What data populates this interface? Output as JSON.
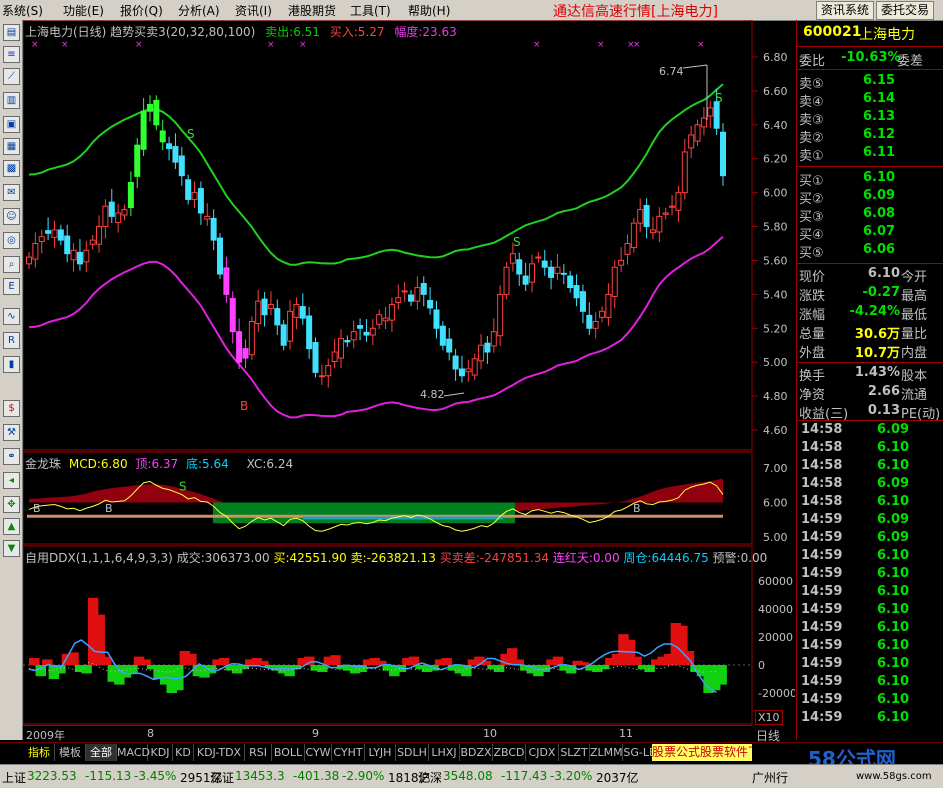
{
  "menu": [
    "系统(S)",
    "功能(E)",
    "报价(Q)",
    "分析(A)",
    "资讯(I)",
    "港股期货",
    "工具(T)",
    "帮助(H)"
  ],
  "app_title": "通达信高速行情[上海电力]",
  "top_buttons": [
    "资讯系统",
    "委托交易"
  ],
  "toolbar_icons": [
    "page-icon",
    "list-icon",
    "kline-icon",
    "chart-icon",
    "report-icon",
    "table-icon",
    "grid-icon",
    "mail-icon",
    "users-icon",
    "news-icon",
    "magnify-icon",
    "etf-icon",
    "wave-icon",
    "rsi-icon",
    "rank-icon",
    "dollar-icon",
    "tools-icon",
    "link-icon",
    "arrow-left-icon",
    "cross-icon",
    "arrow-up-icon",
    "arrow-down-icon"
  ],
  "main": {
    "title": "上海电力(日线) 趋势买卖3(20,32,80,100)",
    "sell_label": "卖出:6.51",
    "buy_label": "买入:5.27",
    "range_label": "幅度:23.63",
    "high_annot": "6.74",
    "low_annot": "4.82",
    "y_ticks": [
      "6.80",
      "6.60",
      "6.40",
      "6.20",
      "6.00",
      "5.80",
      "5.60",
      "5.40",
      "5.20",
      "5.00",
      "4.80",
      "4.60"
    ],
    "signal_s": "S",
    "signal_b": "B"
  },
  "sub1": {
    "name": "金龙珠",
    "mcd": "MCD:6.80",
    "top": "顶:6.37",
    "bottom": "底:5.64",
    "xc": "XC:6.24",
    "y_ticks": [
      "7.00",
      "6.00",
      "5.00"
    ],
    "mark_b": "B",
    "mark_s": "S"
  },
  "sub2": {
    "name": "自用DDX(1,1,1,6,4,9,3,3)",
    "vol": "成交:306373.00",
    "buy": "买:42551.90",
    "sell": "卖:-263821.13",
    "diff": "买卖差:-247851.34",
    "red_days": "连红天:0.00",
    "week": "周仓:64446.75",
    "alert": "预警:0.00",
    "y_ticks": [
      "60000",
      "40000",
      "20000",
      "0",
      "-20000"
    ],
    "scale": "X10"
  },
  "xaxis": {
    "year": "2009年",
    "months": [
      "8",
      "9",
      "10",
      "11"
    ],
    "period": "日线"
  },
  "quote": {
    "code": "600021",
    "name": "上海电力",
    "wb_label": "委比",
    "wb_value": "-10.63%",
    "wc_label": "委差",
    "asks": [
      {
        "l": "卖⑤",
        "p": "6.15"
      },
      {
        "l": "卖④",
        "p": "6.14"
      },
      {
        "l": "卖③",
        "p": "6.13"
      },
      {
        "l": "卖②",
        "p": "6.12"
      },
      {
        "l": "卖①",
        "p": "6.11"
      }
    ],
    "bids": [
      {
        "l": "买①",
        "p": "6.10"
      },
      {
        "l": "买②",
        "p": "6.09"
      },
      {
        "l": "买③",
        "p": "6.08"
      },
      {
        "l": "买④",
        "p": "6.07"
      },
      {
        "l": "买⑤",
        "p": "6.06"
      }
    ],
    "stats": [
      {
        "l": "现价",
        "v": "6.10",
        "r": "今开"
      },
      {
        "l": "涨跌",
        "v": "-0.27",
        "r": "最高"
      },
      {
        "l": "涨幅",
        "v": "-4.24%",
        "r": "最低"
      },
      {
        "l": "总量",
        "v": "30.6万",
        "r": "量比"
      },
      {
        "l": "外盘",
        "v": "10.7万",
        "r": "内盘"
      },
      {
        "l": "换手",
        "v": "1.43%",
        "r": "股本"
      },
      {
        "l": "净资",
        "v": "2.66",
        "r": "流通"
      },
      {
        "l": "收益(三)",
        "v": "0.13",
        "r": "PE(动)"
      }
    ],
    "ticks": [
      {
        "t": "14:58",
        "p": "6.09",
        "c": "g"
      },
      {
        "t": "14:58",
        "p": "6.10",
        "c": "g"
      },
      {
        "t": "14:58",
        "p": "6.10",
        "c": "g"
      },
      {
        "t": "14:58",
        "p": "6.09",
        "c": "g"
      },
      {
        "t": "14:58",
        "p": "6.10",
        "c": "g"
      },
      {
        "t": "14:59",
        "p": "6.09",
        "c": "g"
      },
      {
        "t": "14:59",
        "p": "6.09",
        "c": "g"
      },
      {
        "t": "14:59",
        "p": "6.10",
        "c": "g"
      },
      {
        "t": "14:59",
        "p": "6.10",
        "c": "g"
      },
      {
        "t": "14:59",
        "p": "6.10",
        "c": "g"
      },
      {
        "t": "14:59",
        "p": "6.10",
        "c": "g"
      },
      {
        "t": "14:59",
        "p": "6.10",
        "c": "g"
      },
      {
        "t": "14:59",
        "p": "6.10",
        "c": "g"
      },
      {
        "t": "14:59",
        "p": "6.10",
        "c": "g"
      },
      {
        "t": "14:59",
        "p": "6.10",
        "c": "g"
      },
      {
        "t": "14:59",
        "p": "6.10",
        "c": "g"
      },
      {
        "t": "14:59",
        "p": "6.10",
        "c": "g"
      }
    ]
  },
  "tabs": [
    "指标",
    "模板",
    "全部",
    "MACD",
    "KDJ",
    "KD",
    "KDJ-TDX",
    "RSI",
    "BOLL",
    "CYW",
    "CYHT",
    "LYJH",
    "SDLH",
    "LHXJ",
    "BDZX",
    "ZBCD",
    "CJDX",
    "SLZT",
    "ZLMM",
    "SG-LB"
  ],
  "ad_text": "股票公式股票软件下载",
  "status": [
    {
      "n": "上证",
      "v": "3223.53",
      "c": "-115.13",
      "p": "-3.45%",
      "a": "2951亿"
    },
    {
      "n": "深证",
      "v": "13453.3",
      "c": "-401.38",
      "p": "-2.90%",
      "a": "1818亿"
    },
    {
      "n": "沪深",
      "v": "3548.08",
      "c": "-117.43",
      "p": "-3.20%",
      "a": "2037亿"
    }
  ],
  "status_tail": "广州行",
  "watermark": "58公式网",
  "watermark_url": "www.58gs.com"
}
